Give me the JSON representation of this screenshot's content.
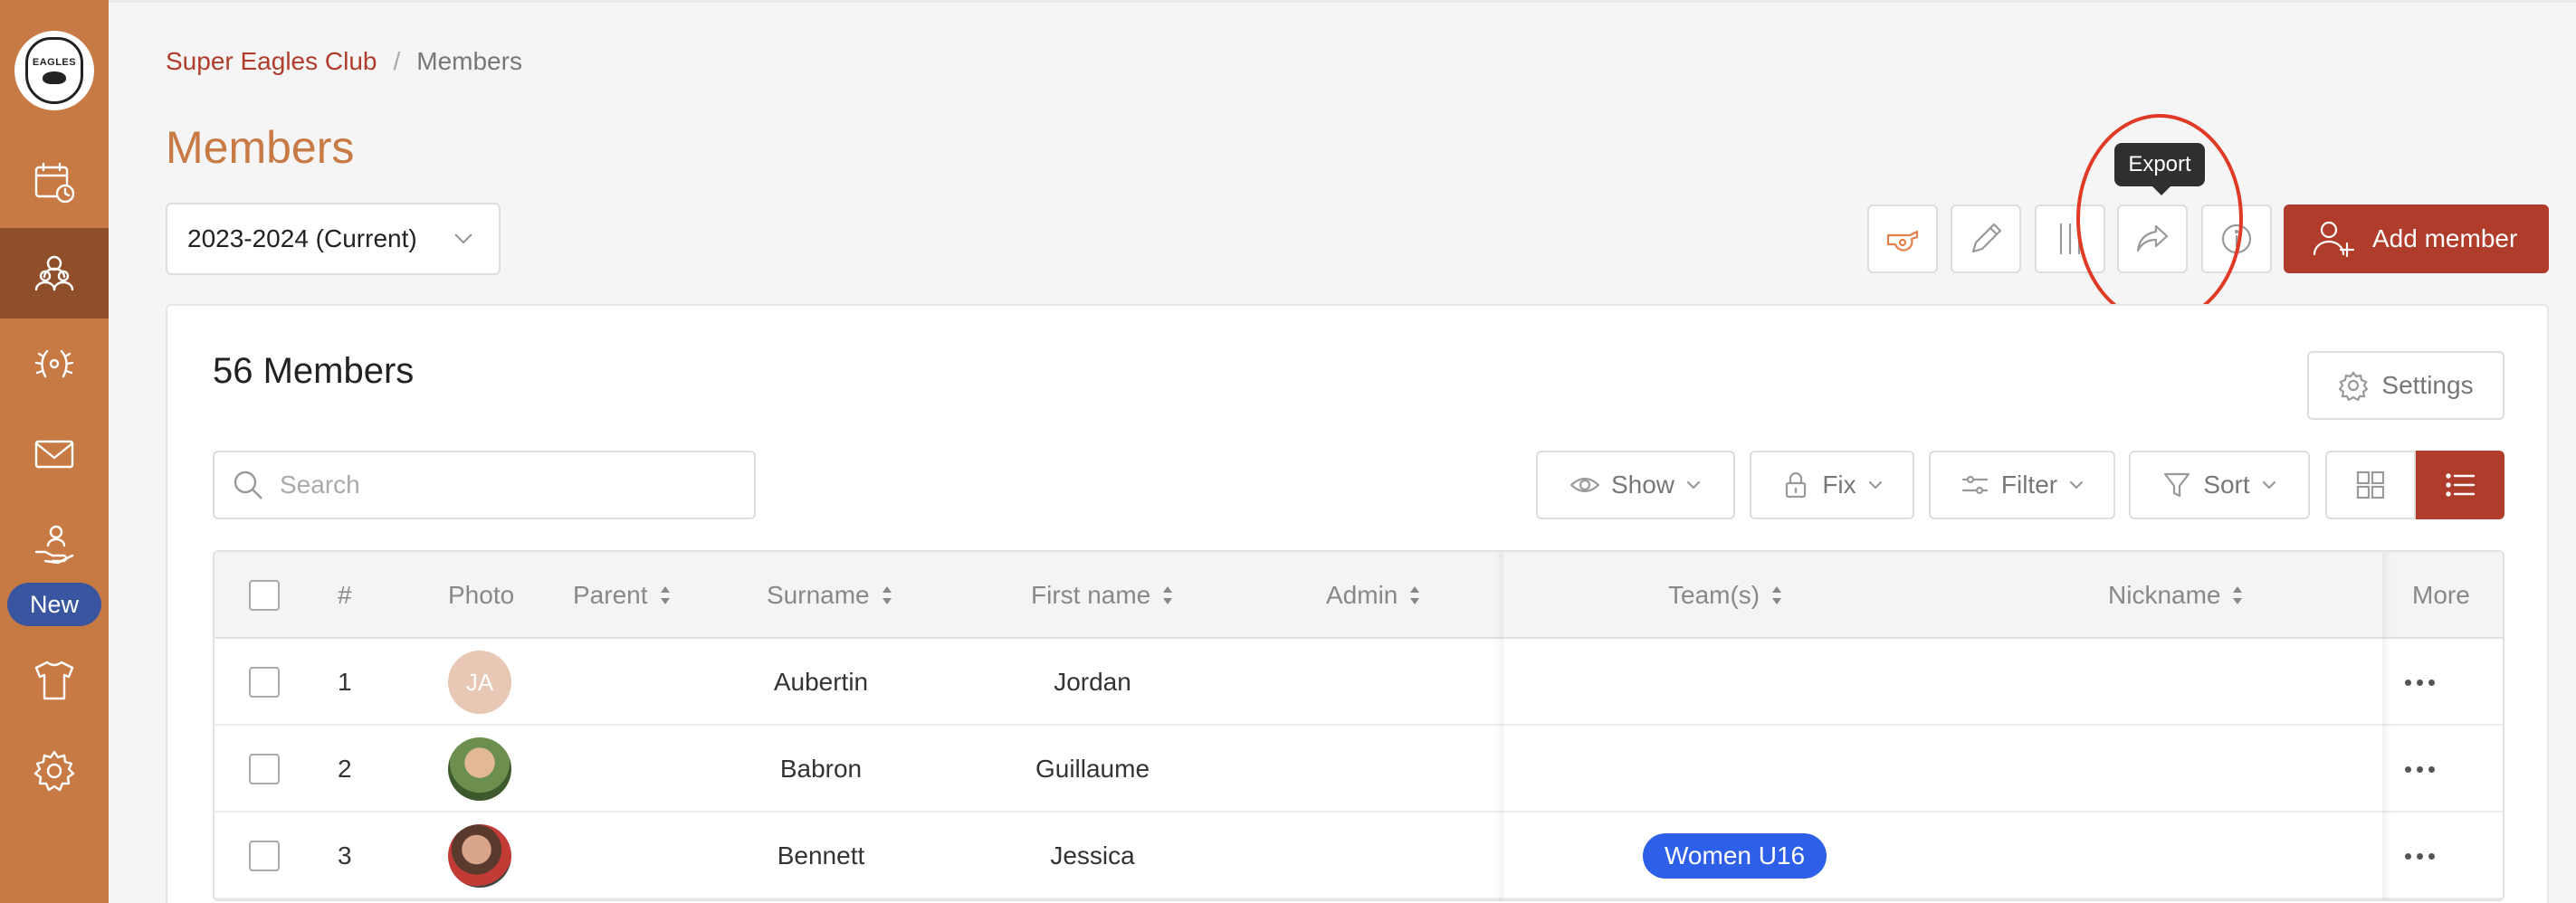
{
  "sidebar": {
    "logo_text": "EAGLES",
    "items": [
      {
        "icon": "calendar-clock-icon"
      },
      {
        "icon": "members-icon",
        "active": true
      },
      {
        "icon": "laurel-icon"
      },
      {
        "icon": "mail-icon"
      },
      {
        "icon": "hand-person-icon",
        "badge": "New"
      },
      {
        "icon": "jersey-icon"
      },
      {
        "icon": "gear-icon"
      }
    ],
    "new_badge": "New"
  },
  "breadcrumb": {
    "club": "Super Eagles Club",
    "separator": "/",
    "current": "Members"
  },
  "page_title": "Members",
  "season": {
    "selected": "2023-2024 (Current)"
  },
  "toolbar": {
    "buttons": [
      "whistle-icon",
      "pencil-icon",
      "columns-icon",
      "export-icon",
      "info-icon"
    ],
    "tooltip": "Export",
    "add_label": "Add member"
  },
  "card": {
    "count_title": "56 Members",
    "settings_label": "Settings",
    "search_placeholder": "Search",
    "controls": {
      "show": "Show",
      "fix": "Fix",
      "filter": "Filter",
      "sort": "Sort"
    }
  },
  "table": {
    "headers": {
      "number": "#",
      "photo": "Photo",
      "parent": "Parent",
      "surname": "Surname",
      "first_name": "First name",
      "admin": "Admin",
      "teams": "Team(s)",
      "nickname": "Nickname",
      "more": "More"
    },
    "rows": [
      {
        "number": "1",
        "initials": "JA",
        "surname": "Aubertin",
        "first_name": "Jordan",
        "team": ""
      },
      {
        "number": "2",
        "initials": "",
        "surname": "Babron",
        "first_name": "Guillaume",
        "team": ""
      },
      {
        "number": "3",
        "initials": "",
        "surname": "Bennett",
        "first_name": "Jessica",
        "team": "Women U16"
      }
    ]
  },
  "colors": {
    "sidebar": "#c87a45",
    "sidebar_active": "#8f4f2b",
    "primary_red": "#b03c2b",
    "title_orange": "#c87a45",
    "team_tag": "#2d5fe8",
    "highlight": "#e03a26"
  }
}
